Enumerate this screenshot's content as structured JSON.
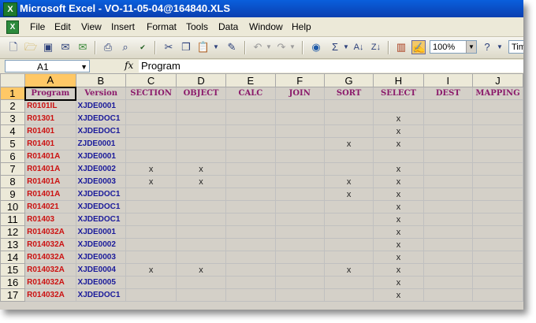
{
  "window": {
    "title": "Microsoft Excel - VO-11-05-04@164840.XLS",
    "app_icon": "excel-icon"
  },
  "menu": [
    "File",
    "Edit",
    "View",
    "Insert",
    "Format",
    "Tools",
    "Data",
    "Window",
    "Help"
  ],
  "toolbar": {
    "zoom": "100%",
    "font": "Tim"
  },
  "formula_bar": {
    "cell_ref": "A1",
    "fx": "fx",
    "content": "Program"
  },
  "grid": {
    "columns": [
      "A",
      "B",
      "C",
      "D",
      "E",
      "F",
      "G",
      "H",
      "I",
      "J"
    ],
    "selected_column": "A",
    "selected_row": "1",
    "header_row": [
      "Program",
      "Version",
      "SECTION",
      "OBJECT",
      "CALC",
      "JOIN",
      "SORT",
      "SELECT",
      "DEST",
      "MAPPING"
    ],
    "rows": [
      {
        "n": "2",
        "program": "R0101IL",
        "version": "XJDE0001",
        "marks": [
          "",
          "",
          "",
          "",
          "",
          "",
          "",
          ""
        ]
      },
      {
        "n": "3",
        "program": "R01301",
        "version": "XJDEDOC1",
        "marks": [
          "",
          "",
          "",
          "",
          "",
          "x",
          "",
          ""
        ]
      },
      {
        "n": "4",
        "program": "R01401",
        "version": "XJDEDOC1",
        "marks": [
          "",
          "",
          "",
          "",
          "",
          "x",
          "",
          ""
        ]
      },
      {
        "n": "5",
        "program": "R01401",
        "version": "ZJDE0001",
        "marks": [
          "",
          "",
          "",
          "",
          "x",
          "x",
          "",
          ""
        ]
      },
      {
        "n": "6",
        "program": "R01401A",
        "version": "XJDE0001",
        "marks": [
          "",
          "",
          "",
          "",
          "",
          "",
          "",
          ""
        ]
      },
      {
        "n": "7",
        "program": "R01401A",
        "version": "XJDE0002",
        "marks": [
          "x",
          "x",
          "",
          "",
          "",
          "x",
          "",
          ""
        ]
      },
      {
        "n": "8",
        "program": "R01401A",
        "version": "XJDE0003",
        "marks": [
          "x",
          "x",
          "",
          "",
          "x",
          "x",
          "",
          ""
        ]
      },
      {
        "n": "9",
        "program": "R01401A",
        "version": "XJDEDOC1",
        "marks": [
          "",
          "",
          "",
          "",
          "x",
          "x",
          "",
          ""
        ]
      },
      {
        "n": "10",
        "program": "R014021",
        "version": "XJDEDOC1",
        "marks": [
          "",
          "",
          "",
          "",
          "",
          "x",
          "",
          ""
        ]
      },
      {
        "n": "11",
        "program": "R01403",
        "version": "XJDEDOC1",
        "marks": [
          "",
          "",
          "",
          "",
          "",
          "x",
          "",
          ""
        ]
      },
      {
        "n": "12",
        "program": "R014032A",
        "version": "XJDE0001",
        "marks": [
          "",
          "",
          "",
          "",
          "",
          "x",
          "",
          ""
        ]
      },
      {
        "n": "13",
        "program": "R014032A",
        "version": "XJDE0002",
        "marks": [
          "",
          "",
          "",
          "",
          "",
          "x",
          "",
          ""
        ]
      },
      {
        "n": "14",
        "program": "R014032A",
        "version": "XJDE0003",
        "marks": [
          "",
          "",
          "",
          "",
          "",
          "x",
          "",
          ""
        ]
      },
      {
        "n": "15",
        "program": "R014032A",
        "version": "XJDE0004",
        "marks": [
          "x",
          "x",
          "",
          "",
          "x",
          "x",
          "",
          ""
        ]
      },
      {
        "n": "16",
        "program": "R014032A",
        "version": "XJDE0005",
        "marks": [
          "",
          "",
          "",
          "",
          "",
          "x",
          "",
          ""
        ]
      },
      {
        "n": "17",
        "program": "R014032A",
        "version": "XJDEDOC1",
        "marks": [
          "",
          "",
          "",
          "",
          "",
          "x",
          "",
          ""
        ]
      }
    ]
  }
}
